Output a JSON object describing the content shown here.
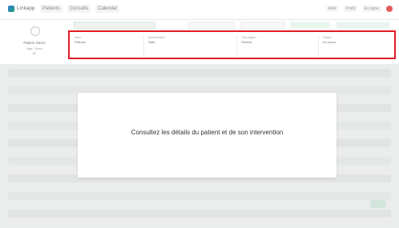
{
  "brand": {
    "name": "Linkapp"
  },
  "nav": {
    "items": [
      "Patients",
      "Consults",
      "Calendar"
    ]
  },
  "topbar": {
    "chip_left": "Aide",
    "chip_right": "Profil",
    "status_label": "En ligne"
  },
  "patient": {
    "name": "Patient Name",
    "line1": "Age / Sexe",
    "line2": "ID"
  },
  "info_box": {
    "col1": {
      "label": "Nom",
      "value": "Prénom"
    },
    "col2": {
      "label": "Intervention",
      "value": "Date"
    },
    "col3": {
      "label": "Chirurgien",
      "value": "Service"
    },
    "col4": {
      "label": "Statut",
      "value": "En cours"
    }
  },
  "tooltip": {
    "text": "Consultez les détails du patient et de son intervention"
  },
  "colors": {
    "highlight_border": "#e31b23",
    "accent": "#1aa07a"
  }
}
